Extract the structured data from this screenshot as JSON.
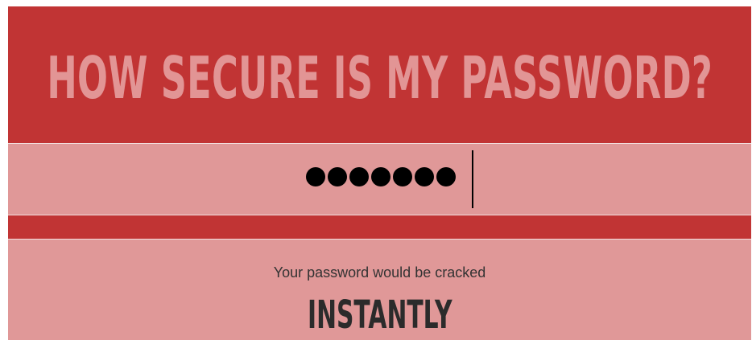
{
  "header": {
    "title": "HOW SECURE IS MY PASSWORD?"
  },
  "password_field": {
    "masked_char_count": 7,
    "caret_visible": true
  },
  "result": {
    "text": "Your password would be cracked",
    "verdict": "INSTANTLY"
  },
  "colors": {
    "header_bg": "#c13434",
    "title_text": "#e29595",
    "band_bg": "#e09898",
    "verdict_text": "#2b2b2b"
  }
}
